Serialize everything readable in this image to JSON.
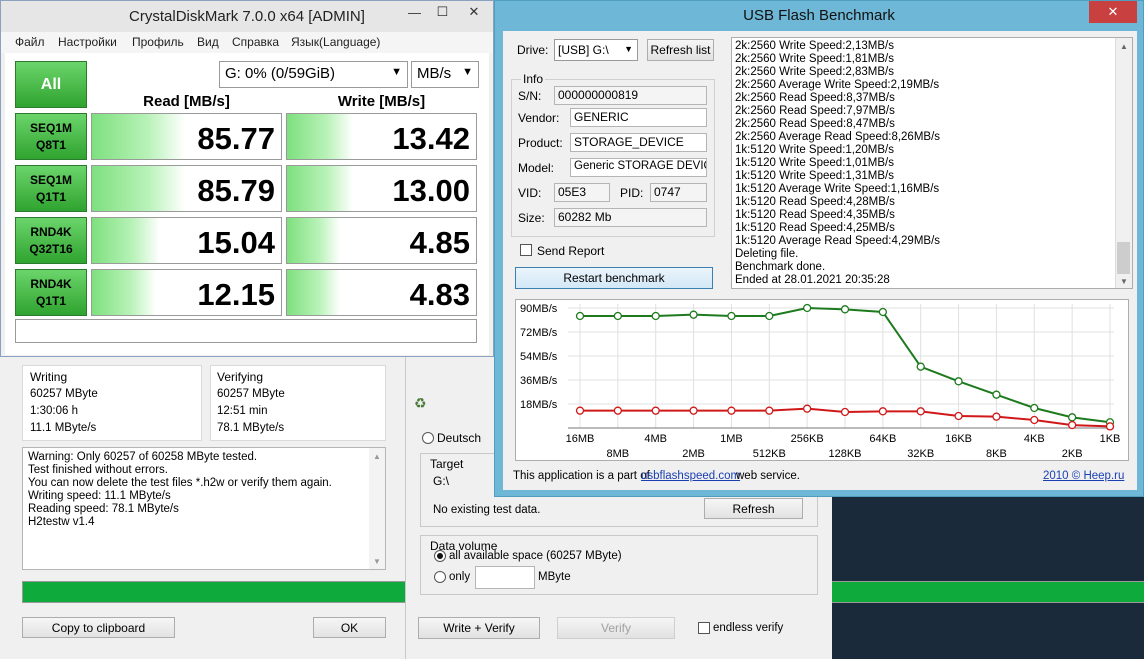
{
  "cdm": {
    "title": "CrystalDiskMark 7.0.0 x64 [ADMIN]",
    "window_controls": [
      "—",
      "☐",
      "✕"
    ],
    "menu": [
      "Файл",
      "Настройки",
      "Профиль",
      "Вид",
      "Справка",
      "Язык(Language)"
    ],
    "all_label": "All",
    "drive_select": "G: 0% (0/59GiB)",
    "unit_select": "MB/s",
    "read_header": "Read [MB/s]",
    "write_header": "Write [MB/s]",
    "tests": [
      {
        "line1": "SEQ1M",
        "line2": "Q8T1",
        "read": "85.77",
        "write": "13.42",
        "read_fill": 0.49,
        "write_fill": 0.35
      },
      {
        "line1": "SEQ1M",
        "line2": "Q1T1",
        "read": "85.79",
        "write": "13.00",
        "read_fill": 0.49,
        "write_fill": 0.35
      },
      {
        "line1": "RND4K",
        "line2": "Q32T16",
        "read": "15.04",
        "write": "4.85",
        "read_fill": 0.36,
        "write_fill": 0.28
      },
      {
        "line1": "RND4K",
        "line2": "Q1T1",
        "read": "12.15",
        "write": "4.83",
        "read_fill": 0.34,
        "write_fill": 0.28
      }
    ]
  },
  "h2": {
    "writing_label": "Writing",
    "writing_size": "60257 MByte",
    "writing_time": "1:30:06 h",
    "writing_speed": "11.1 MByte/s",
    "verifying_label": "Verifying",
    "verifying_size": "60257 MByte",
    "verifying_time": "12:51 min",
    "verifying_speed": "78.1 MByte/s",
    "message_lines": [
      "Warning: Only 60257 of 60258 MByte tested.",
      "Test finished without errors.",
      "You can now delete the test files *.h2w or verify them again.",
      "Writing speed: 11.1 MByte/s",
      "Reading speed: 78.1 MByte/s",
      "H2testw v1.4"
    ],
    "progress": 1.0,
    "copy_button": "Copy to clipboard",
    "ok_button": "OK",
    "lang_deutsch": "Deutsch",
    "target_label": "Target",
    "target_value": "G:\\",
    "no_test_data": "No existing test data.",
    "refresh_button": "Refresh",
    "data_volume_label": "Data volume",
    "all_space_label": "all available space (60257 MByte)",
    "only_label": "only",
    "mbyte_label": "MByte",
    "write_verify_button": "Write + Verify",
    "verify_button": "Verify",
    "endless_verify_label": "endless verify"
  },
  "usb": {
    "title": "USB Flash Benchmark",
    "window_controls": [
      "✕"
    ],
    "drive_label": "Drive:",
    "drive_select": "[USB] G:\\",
    "refresh_list": "Refresh list",
    "info_label": "Info",
    "sn_label": "S/N:",
    "sn_value": "000000000819",
    "vendor_label": "Vendor:",
    "vendor_value": "GENERIC",
    "product_label": "Product:",
    "product_value": "STORAGE_DEVICE",
    "model_label": "Model:",
    "model_value": "Generic STORAGE DEVICE",
    "vid_label": "VID:",
    "vid_value": "05E3",
    "pid_label": "PID:",
    "pid_value": "0747",
    "size_label": "Size:",
    "size_value": "60282 Mb",
    "send_report": "Send Report",
    "restart_button": "Restart benchmark",
    "log_lines": [
      "2k:2560 Write Speed:2,13MB/s",
      "2k:2560 Write Speed:1,81MB/s",
      "2k:2560 Write Speed:2,83MB/s",
      "2k:2560 Average Write Speed:2,19MB/s",
      "2k:2560 Read Speed:8,37MB/s",
      "2k:2560 Read Speed:7,97MB/s",
      "2k:2560 Read Speed:8,47MB/s",
      "2k:2560 Average Read Speed:8,26MB/s",
      "1k:5120 Write Speed:1,20MB/s",
      "1k:5120 Write Speed:1,01MB/s",
      "1k:5120 Write Speed:1,31MB/s",
      "1k:5120 Average Write Speed:1,16MB/s",
      "1k:5120 Read Speed:4,28MB/s",
      "1k:5120 Read Speed:4,35MB/s",
      "1k:5120 Read Speed:4,25MB/s",
      "1k:5120 Average Read Speed:4,29MB/s",
      "Deleting file.",
      "Benchmark done.",
      "Ended at 28.01.2021 20:35:28"
    ],
    "footer_text": "This application is a part of",
    "footer_link": "usbflashspeed.com",
    "footer_suffix": "web service.",
    "footer_right": "2010 © Heep.ru"
  },
  "chart_data": {
    "type": "line",
    "categories": [
      "16MB",
      "8MB",
      "4MB",
      "2MB",
      "1MB",
      "512KB",
      "256KB",
      "128KB",
      "64KB",
      "32KB",
      "16KB",
      "8KB",
      "4KB",
      "2KB",
      "1KB"
    ],
    "yticks": [
      "18MB/s",
      "36MB/s",
      "54MB/s",
      "72MB/s",
      "90MB/s"
    ],
    "ylim": [
      0,
      90
    ],
    "series": [
      {
        "color": "#1e7a1e",
        "values": [
          84.0,
          84.0,
          84.0,
          85.0,
          84.0,
          84.0,
          90.0,
          89.0,
          87.0,
          46.0,
          35.0,
          25.0,
          15.0,
          8.0,
          4.3
        ]
      },
      {
        "color": "#d01818",
        "values": [
          13.0,
          13.0,
          13.0,
          13.0,
          13.0,
          13.0,
          14.5,
          12.0,
          12.5,
          12.5,
          9.0,
          8.5,
          6.0,
          2.2,
          1.2
        ]
      }
    ]
  }
}
